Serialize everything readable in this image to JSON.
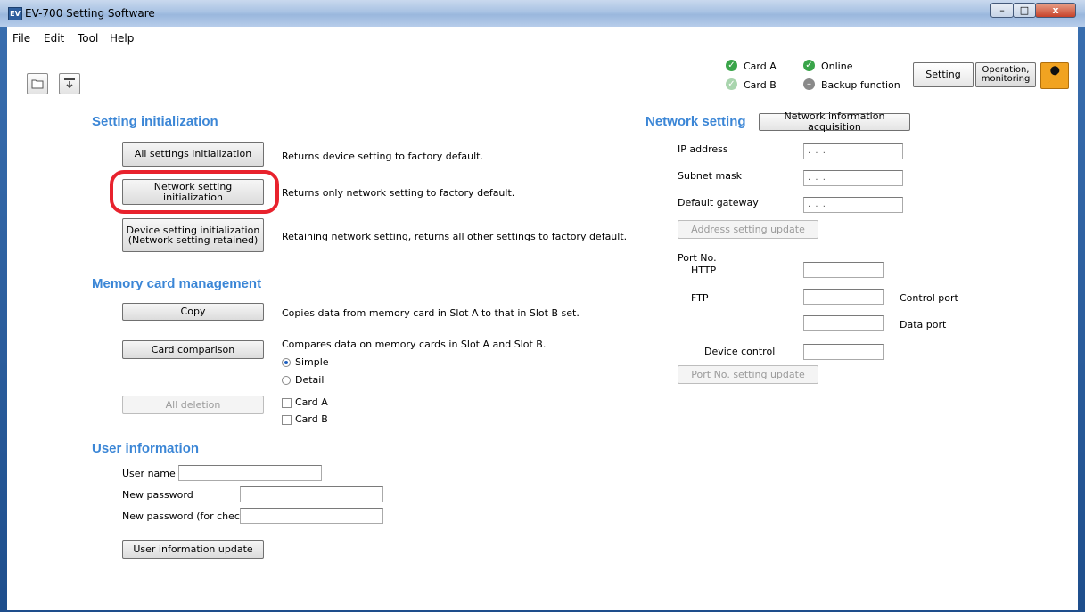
{
  "window": {
    "title": "EV-700 Setting Software",
    "app_icon_text": "EV",
    "controls": {
      "minimize": "–",
      "maximize": "□",
      "close": "x"
    }
  },
  "menu": [
    "File",
    "Edit",
    "Tool",
    "Help"
  ],
  "toolbar": {
    "icons": [
      "folder-open-icon",
      "download-icon"
    ]
  },
  "status": {
    "card_a": "Card A",
    "card_b": "Card B",
    "online": "Online",
    "backup": "Backup function",
    "colors": {
      "ok": "#3aa54a",
      "ok_dim": "#a9d5ae",
      "off": "#8a8a8a"
    }
  },
  "mode_buttons": {
    "setting": "Setting",
    "operation": "Operation,\nmonitoring"
  },
  "setting_init": {
    "title": "Setting initialization",
    "rows": [
      {
        "button": "All settings initialization",
        "desc": "Returns device setting to factory default."
      },
      {
        "button": "Network setting initialization",
        "desc": "Returns only network setting to factory default."
      },
      {
        "button": "Device setting initialization\n(Network setting retained)",
        "desc": "Retaining network setting, returns all other settings to factory default."
      }
    ]
  },
  "memory": {
    "title": "Memory card management",
    "copy_button": "Copy",
    "copy_desc": "Copies data from memory card in Slot A to that in Slot B set.",
    "compare_button": "Card comparison",
    "compare_desc": "Compares data on memory cards in Slot A and Slot B.",
    "radio_simple": "Simple",
    "radio_detail": "Detail",
    "selected_mode": "Simple",
    "delete_button": "All deletion",
    "check_card_a": "Card A",
    "check_card_b": "Card B"
  },
  "user": {
    "title": "User information",
    "user_name_label": "User name",
    "new_password_label": "New password",
    "new_password_check_label": "New password (for check)",
    "update_button": "User information update"
  },
  "network": {
    "title": "Network setting",
    "acquire_button": "Network information acquisition",
    "ip_label": "IP address",
    "subnet_label": "Subnet mask",
    "gateway_label": "Default gateway",
    "ip_dots": ". . .",
    "address_update_button": "Address setting update",
    "port_label": "Port No.",
    "http_label": "HTTP",
    "ftp_label": "FTP",
    "control_port_label": "Control port",
    "data_port_label": "Data port",
    "device_control_label": "Device control",
    "port_update_button": "Port No. setting update"
  },
  "accent": {
    "section_title": "#3b86d6",
    "highlight": "#e8222d"
  }
}
